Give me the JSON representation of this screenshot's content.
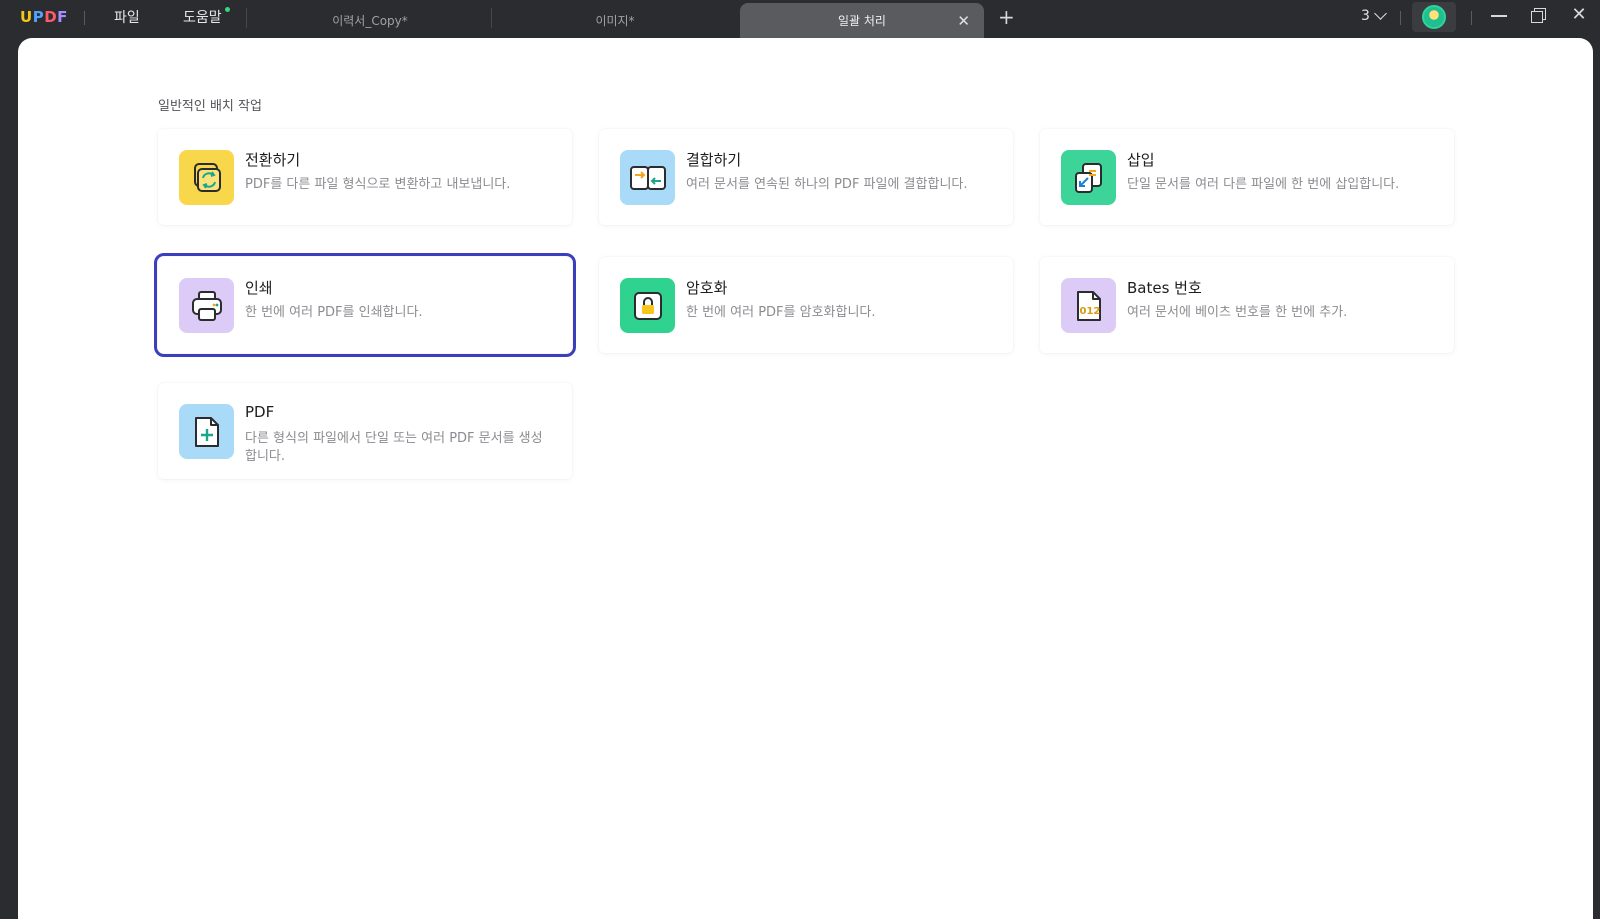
{
  "titlebar": {
    "logo": "UPDF",
    "menu": [
      {
        "label": "파일"
      },
      {
        "label": "도움말"
      }
    ],
    "tabs": [
      {
        "label": "이력서_Copy*"
      },
      {
        "label": "이미지*"
      },
      {
        "label": "일괄 처리",
        "active": true
      }
    ],
    "add_tab": "+",
    "open_count": "3",
    "close_symbol": "✕"
  },
  "main": {
    "section_title": "일반적인 배치 작업",
    "cards": [
      {
        "title": "전환하기",
        "desc": "PDF를 다른 파일 형식으로 변환하고 내보냅니다.",
        "icon": "convert-icon",
        "icon_bg": "#f8d84a"
      },
      {
        "title": "결합하기",
        "desc": "여러 문서를 연속된 하나의 PDF 파일에 결합합니다.",
        "icon": "combine-icon",
        "icon_bg": "#a9daf7"
      },
      {
        "title": "삽입",
        "desc": "단일 문서를 여러 다른 파일에 한 번에 삽입합니다.",
        "icon": "insert-icon",
        "icon_bg": "#3dd49a"
      },
      {
        "title": "인쇄",
        "desc": "한 번에 여러 PDF를 인쇄합니다.",
        "icon": "printer-icon",
        "icon_bg": "#dccbf7",
        "selected": true
      },
      {
        "title": "암호화",
        "desc": "한 번에 여러 PDF를 암호화합니다.",
        "icon": "lock-icon",
        "icon_bg": "#2fd38f"
      },
      {
        "title": "Bates 번호",
        "desc": "여러 문서에 베이츠 번호를 한 번에 추가.",
        "icon": "bates-number-icon",
        "icon_bg": "#dccbf7",
        "icon_text": "012"
      },
      {
        "title": "PDF",
        "desc": "다른 형식의 파일에서 단일 또는 여러 PDF 문서를 생성합니다.",
        "icon": "create-pdf-icon",
        "icon_bg": "#a9daf7"
      }
    ]
  }
}
